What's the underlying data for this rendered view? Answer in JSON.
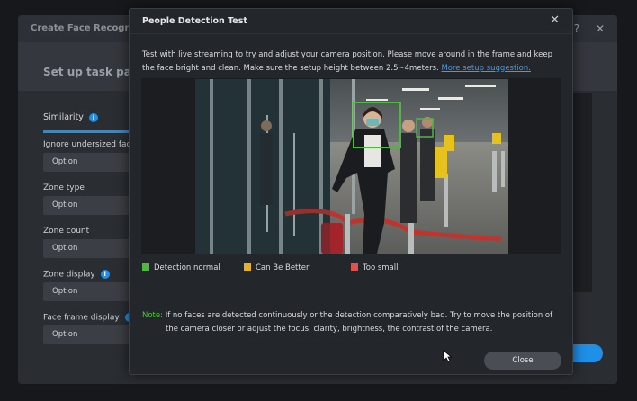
{
  "background_window": {
    "title": "Create Face Recognitio",
    "help_icon": "?",
    "close_icon": "✕",
    "subtitle": "Set up task para",
    "tab_label": "Similarity",
    "fields": [
      {
        "label": "Ignore undersized fac",
        "value": "Option",
        "has_info": false
      },
      {
        "label": "Zone type",
        "value": "Option",
        "has_info": false
      },
      {
        "label": "Zone count",
        "value": "Option",
        "has_info": false
      },
      {
        "label": "Zone display",
        "value": "Option",
        "has_info": true
      },
      {
        "label": "Face frame display",
        "value": "Option",
        "has_info": true
      }
    ],
    "info_glyph": "i",
    "accent_color": "#1f8fe8"
  },
  "dialog": {
    "title": "People Detection Test",
    "close_glyph": "✕",
    "instructions": "Test with live streaming to try and adjust your camera position. Please move around in the frame and keep the face bright and clean. Make sure the setup height between 2.5~4meters.",
    "instructions_link": "More setup suggestion.",
    "legend": [
      {
        "label": "Detection normal",
        "color": "#4cbb3a"
      },
      {
        "label": "Can Be Better",
        "color": "#e8b21e"
      },
      {
        "label": "Too small",
        "color": "#e0524e"
      }
    ],
    "note_label": "Note:",
    "note_line1": "If no faces are detected continuously or the detection comparatively bad. Try to move the position of",
    "note_line2": "the camera closer or adjust the focus, clarity, brightness, the contrast of the camera.",
    "close_button": "Close"
  }
}
